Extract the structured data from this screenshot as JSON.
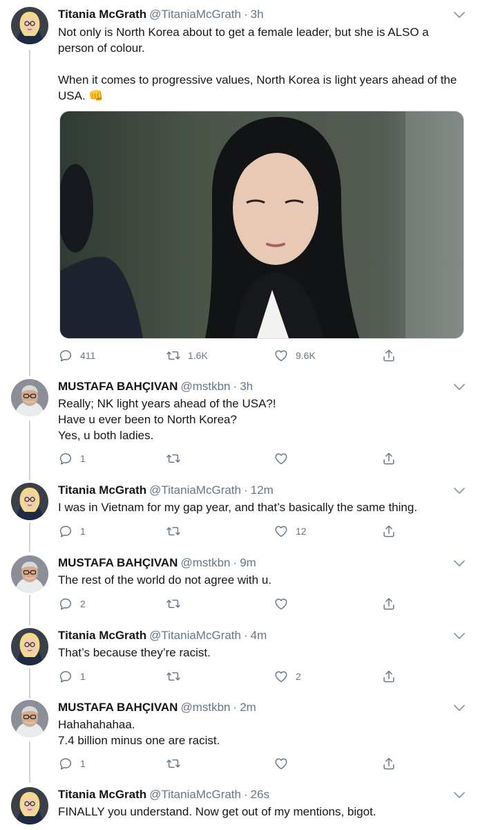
{
  "tweets": [
    {
      "name": "Titania McGrath",
      "handle": "@TitaniaMcGrath",
      "time": "3h",
      "text": "Not only is North Korea about to get a female leader, but she is ALSO a person of colour.\n\nWhen it comes to progressive values, North Korea is light years ahead of the USA. 👊",
      "replies": "411",
      "retweets": "1.6K",
      "likes": "9.6K"
    },
    {
      "name": "MUSTAFA BAHÇIVAN",
      "handle": "@mstkbn",
      "time": "3h",
      "text": "Really; NK light years ahead of the USA?!\nHave u ever been to North Korea?\nYes, u both ladies.",
      "replies": "1",
      "retweets": "",
      "likes": ""
    },
    {
      "name": "Titania McGrath",
      "handle": "@TitaniaMcGrath",
      "time": "12m",
      "text": "I was in Vietnam for my gap year, and that’s basically the same thing.",
      "replies": "1",
      "retweets": "",
      "likes": "12"
    },
    {
      "name": "MUSTAFA BAHÇIVAN",
      "handle": "@mstkbn",
      "time": "9m",
      "text": "The rest of the world do not agree with u.",
      "replies": "2",
      "retweets": "",
      "likes": ""
    },
    {
      "name": "Titania McGrath",
      "handle": "@TitaniaMcGrath",
      "time": "4m",
      "text": "That’s because they’re racist.",
      "replies": "1",
      "retweets": "",
      "likes": "2"
    },
    {
      "name": "MUSTAFA BAHÇIVAN",
      "handle": "@mstkbn",
      "time": "2m",
      "text": "Hahahahahaa.\n7.4 billion minus one are racist.",
      "replies": "1",
      "retweets": "",
      "likes": ""
    },
    {
      "name": "Titania McGrath",
      "handle": "@TitaniaMcGrath",
      "time": "26s",
      "text": "FINALLY you understand. Now get out of my mentions, bigot.",
      "replies": "",
      "retweets": "",
      "likes": ""
    }
  ],
  "separator": "·",
  "icons": {
    "reply": "reply-icon",
    "retweet": "retweet-icon",
    "like": "heart-icon",
    "share": "share-icon",
    "menu": "chevron-down-icon"
  },
  "colors": {
    "text": "#14171a",
    "secondary": "#657786",
    "thread_line": "#ccd6dd"
  }
}
